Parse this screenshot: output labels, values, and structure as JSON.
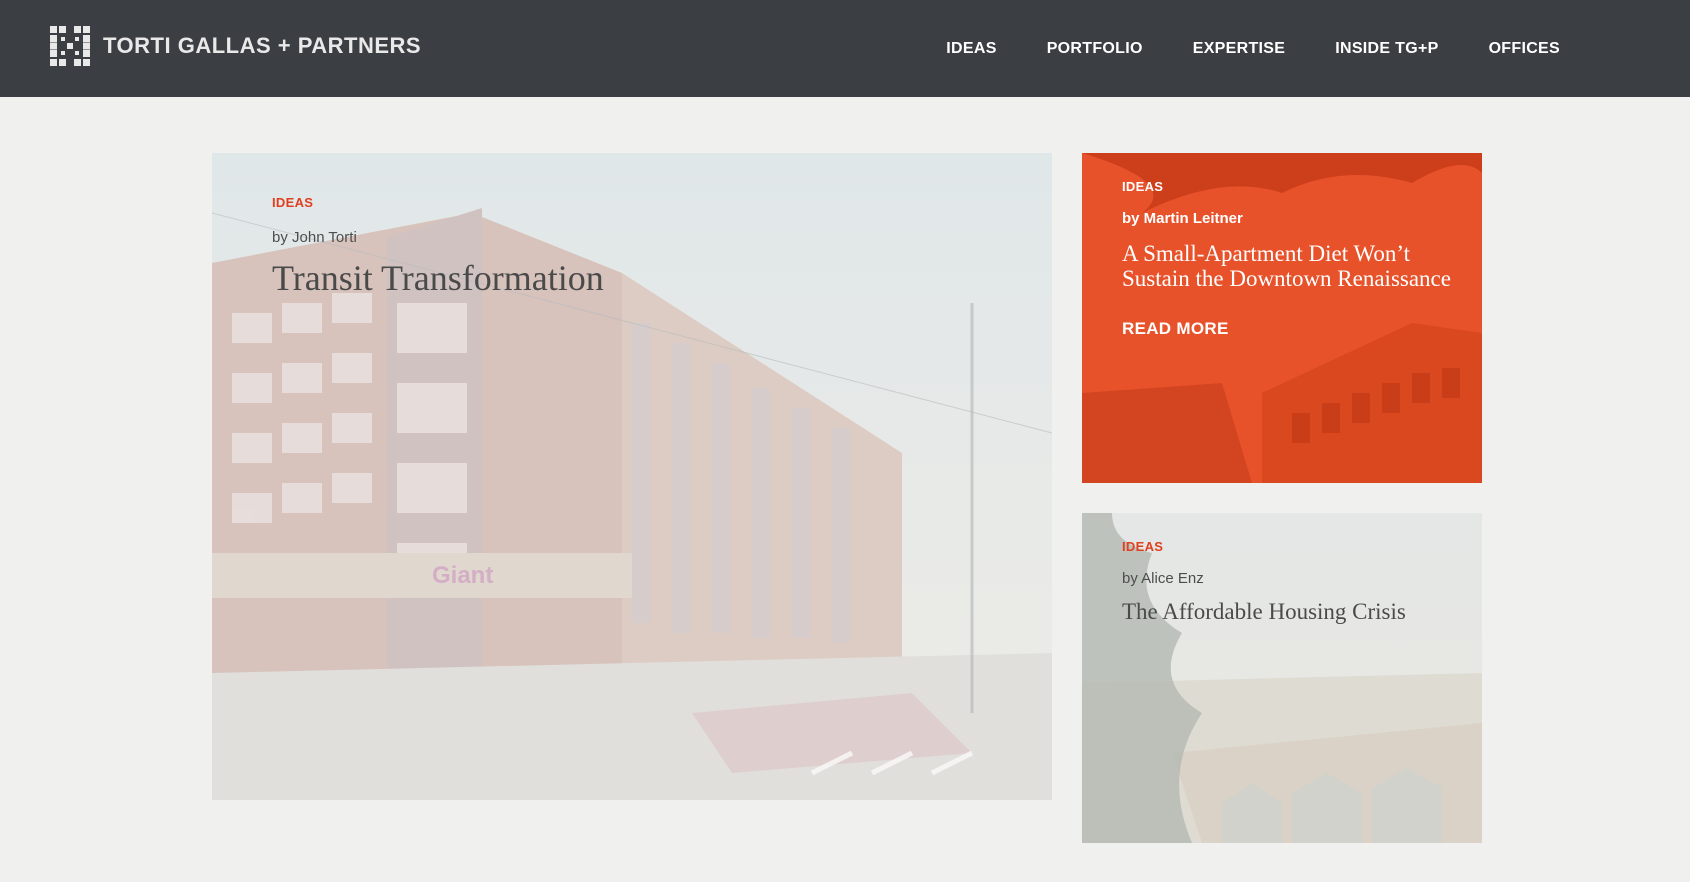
{
  "brand": {
    "name": "TORTI GALLAS + PARTNERS",
    "icon": "grid-logo-icon"
  },
  "nav": {
    "items": [
      {
        "label": "IDEAS"
      },
      {
        "label": "PORTFOLIO"
      },
      {
        "label": "EXPERTISE"
      },
      {
        "label": "INSIDE TG+P"
      },
      {
        "label": "OFFICES"
      }
    ]
  },
  "featured": {
    "tag": "IDEAS",
    "author": "by John Torti",
    "title": "Transit Transformation"
  },
  "cards": [
    {
      "tag": "IDEAS",
      "author": "by Martin Leitner",
      "title": "A Small-Apartment Diet Won’t Sustain the Downtown Renaissance",
      "cta": "READ MORE"
    },
    {
      "tag": "IDEAS",
      "author": "by Alice Enz",
      "title": "The Affordable Housing Crisis"
    }
  ],
  "colors": {
    "header_bg": "#3b3e42",
    "page_bg": "#f0f0ee",
    "accent": "#e0401f",
    "card_overlay": "#e8522a"
  }
}
